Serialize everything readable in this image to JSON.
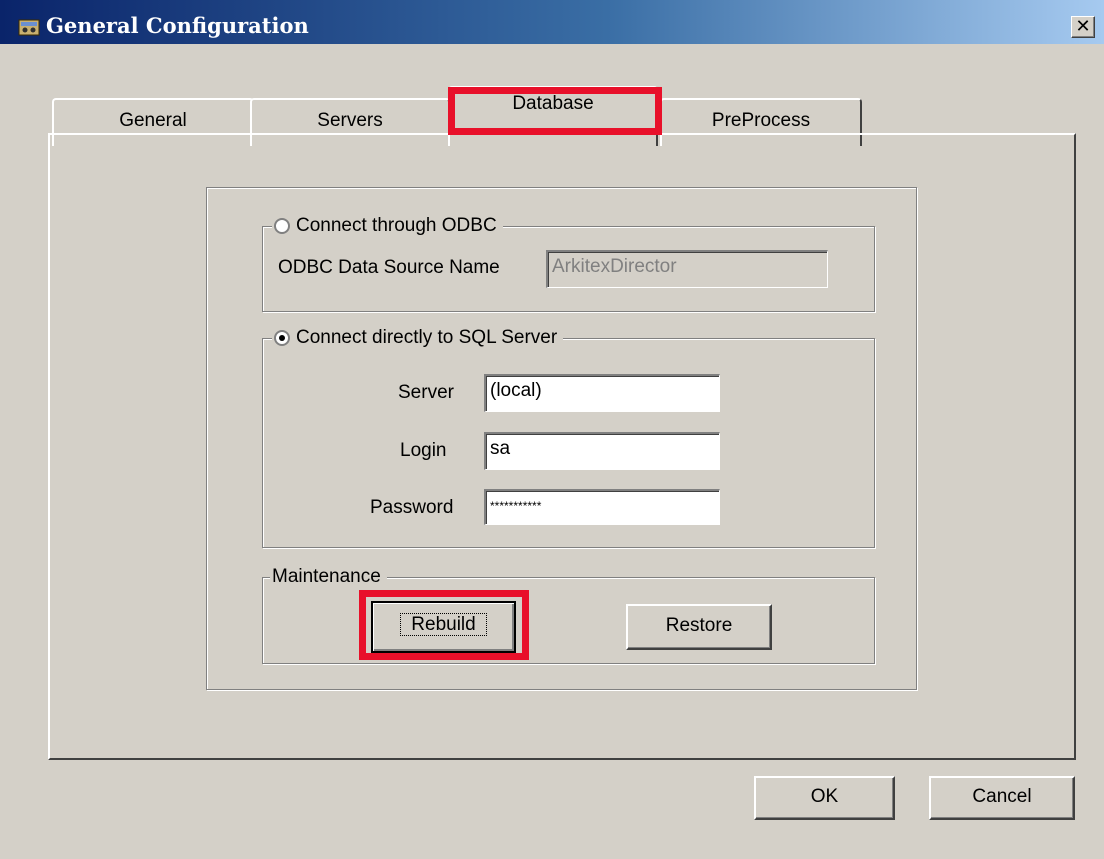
{
  "window": {
    "title": "General Configuration",
    "icon": "app-icon",
    "close_glyph": "✕"
  },
  "tabs": [
    {
      "label": "General",
      "active": false
    },
    {
      "label": "Servers",
      "active": false
    },
    {
      "label": "Database",
      "active": true
    },
    {
      "label": "PreProcess",
      "active": false
    }
  ],
  "odbc": {
    "radio_label": "Connect through ODBC",
    "selected": false,
    "dsn_label": "ODBC Data Source Name",
    "dsn_value": "ArkitexDirector"
  },
  "sql": {
    "radio_label": "Connect directly to SQL Server",
    "selected": true,
    "server_label": "Server",
    "server_value": "(local)",
    "login_label": "Login",
    "login_value": "sa",
    "password_label": "Password",
    "password_value": "***********"
  },
  "maintenance": {
    "label": "Maintenance",
    "rebuild_label": "Rebuild",
    "restore_label": "Restore"
  },
  "footer": {
    "ok_label": "OK",
    "cancel_label": "Cancel"
  },
  "highlight_color": "#e8102a"
}
